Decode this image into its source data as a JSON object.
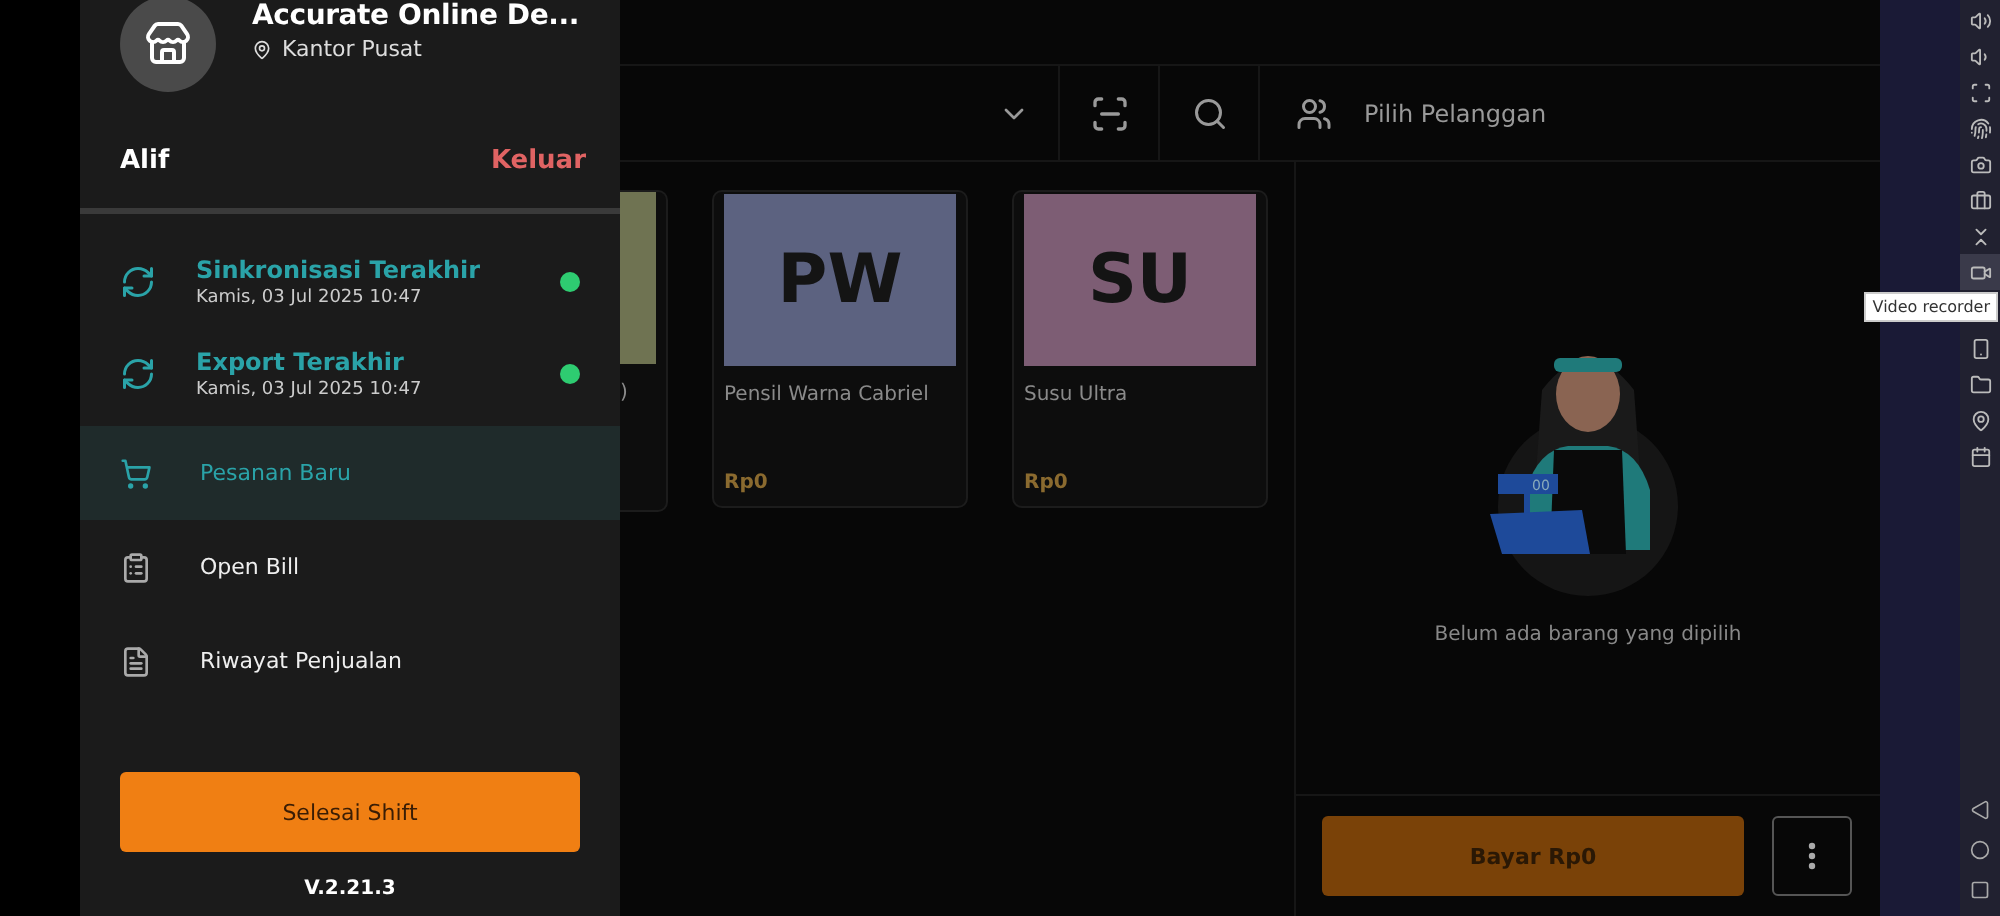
{
  "drawer": {
    "store_name": "Accurate Online De...",
    "location": "Kantor Pusat",
    "user": "Alif",
    "logout": "Keluar",
    "sync_items": [
      {
        "title": "Sinkronisasi Terakhir",
        "time": "Kamis, 03 Jul 2025 10:47",
        "color": "#2ecc71"
      },
      {
        "title": "Export Terakhir",
        "time": "Kamis, 03 Jul 2025 10:47",
        "color": "#2ecc71"
      }
    ],
    "menu": [
      {
        "kind": "cart",
        "label": "Pesanan Baru",
        "selected": true
      },
      {
        "kind": "bill",
        "label": "Open Bill",
        "selected": false
      },
      {
        "kind": "history",
        "label": "Riwayat Penjualan",
        "selected": false
      }
    ],
    "end_shift_button": "Selesai Shift",
    "version": "V.2.21.3"
  },
  "toolbar": {
    "customer_placeholder": "Pilih Pelanggan"
  },
  "products": [
    {
      "kind": "partial",
      "name": ")",
      "color": "#6f7352"
    },
    {
      "kind": "card",
      "initials": "PW",
      "name": "Pensil Warna Cabriel",
      "price": "Rp0",
      "color": "#5c6280"
    },
    {
      "kind": "card",
      "initials": "SU",
      "name": "Susu Ultra",
      "price": "Rp0",
      "color": "#7d5d74"
    }
  ],
  "cart": {
    "register_display": "00",
    "empty_message": "Belum ada barang yang dipilih",
    "pay_button": "Bayar Rp0"
  },
  "emulator": {
    "tooltip": "Video recorder",
    "tools": [
      {
        "kind": "volume-up",
        "selected": false
      },
      {
        "kind": "volume-down",
        "selected": false
      },
      {
        "kind": "screenshot",
        "selected": false
      },
      {
        "kind": "fingerprint",
        "selected": false
      },
      {
        "kind": "camera",
        "selected": false
      },
      {
        "kind": "briefcase",
        "selected": false
      },
      {
        "kind": "collapse",
        "selected": false
      },
      {
        "kind": "video",
        "selected": true
      },
      {
        "kind": "phone",
        "selected": false
      },
      {
        "kind": "folder",
        "selected": false
      },
      {
        "kind": "location",
        "selected": false
      },
      {
        "kind": "calendar",
        "selected": false
      }
    ]
  }
}
